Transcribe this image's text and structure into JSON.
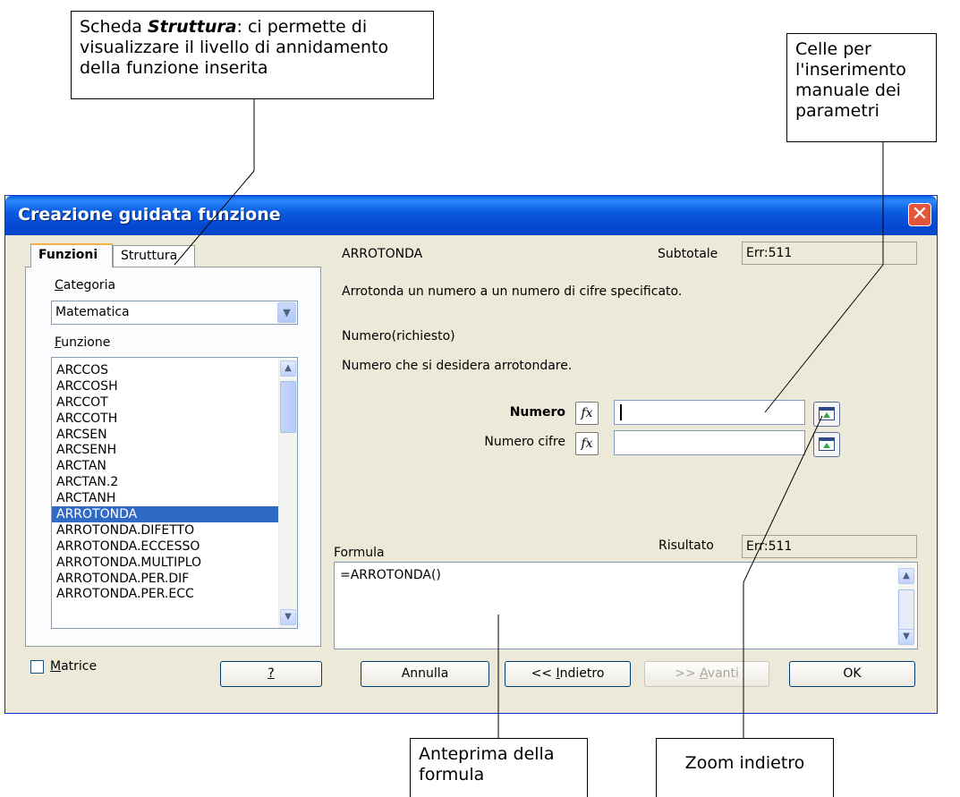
{
  "annotations": {
    "struttura_prefix": "Scheda ",
    "struttura_bold": "Struttura",
    "struttura_rest": ": ci permette di visualizzare il livello di annidamento della funzione inserita",
    "celle": "Celle per l'inserimento manuale dei parametri",
    "anteprima": "Anteprima della formula",
    "zoom": "Zoom indietro"
  },
  "dialog": {
    "title": "Creazione guidata funzione",
    "close_icon": "close-icon"
  },
  "tabs": [
    {
      "label": "Funzioni",
      "active": true
    },
    {
      "label": "Struttura",
      "active": false
    }
  ],
  "left": {
    "category_label_ul": "C",
    "category_label_rest": "ategoria",
    "category_value": "Matematica",
    "function_label_ul": "F",
    "function_label_rest": "unzione",
    "functions": [
      "ARCCOS",
      "ARCCOSH",
      "ARCCOT",
      "ARCCOTH",
      "ARCSEN",
      "ARCSENH",
      "ARCTAN",
      "ARCTAN.2",
      "ARCTANH",
      "ARROTONDA",
      "ARROTONDA.DIFETTO",
      "ARROTONDA.ECCESSO",
      "ARROTONDA.MULTIPLO",
      "ARROTONDA.PER.DIF",
      "ARROTONDA.PER.ECC"
    ],
    "selected_function": "ARROTONDA",
    "matrix_label_ul": "M",
    "matrix_label_rest": "atrice"
  },
  "right": {
    "function_name": "ARROTONDA",
    "subtotal_label": "Subtotale",
    "subtotal_value": "Err:511",
    "description": "Arrotonda un numero a un numero di cifre specificato.",
    "param_title": "Numero(richiesto)",
    "param_desc": "Numero che si desidera arrotondare.",
    "param1_label": "Numero",
    "param1_value": "",
    "param2_label": "Numero cifre",
    "param2_value": "",
    "fx_label": "fx",
    "formula_label": "Formula",
    "result_label": "Risultato",
    "result_value": "Err:511",
    "formula_text": "=ARROTONDA()"
  },
  "buttons": {
    "help": "?",
    "cancel": "Annulla",
    "back_prefix": "<< ",
    "back_ul": "I",
    "back_rest": "ndietro",
    "next_prefix": ">> ",
    "next_ul": "A",
    "next_rest": "vanti",
    "ok": "OK"
  }
}
